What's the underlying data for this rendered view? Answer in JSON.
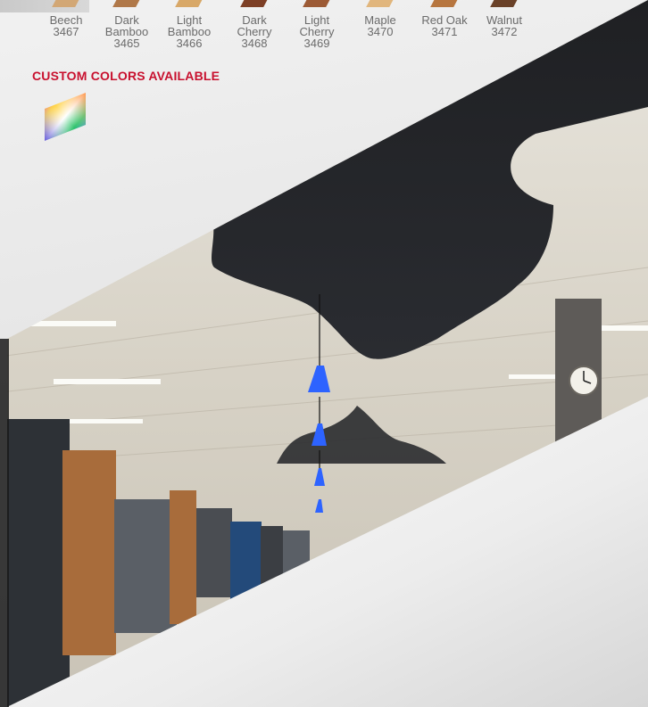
{
  "swatches": [
    {
      "name": "Beech",
      "code": "3467",
      "color": "#d2a775"
    },
    {
      "name": "Dark\nBamboo",
      "code": "3465",
      "color": "#b07849"
    },
    {
      "name": "Light\nBamboo",
      "code": "3466",
      "color": "#d8a868"
    },
    {
      "name": "Dark\nCherry",
      "code": "3468",
      "color": "#7d3f25"
    },
    {
      "name": "Light\nCherry",
      "code": "3469",
      "color": "#9c5a35"
    },
    {
      "name": "Maple",
      "code": "3470",
      "color": "#e1b67d"
    },
    {
      "name": "Red Oak",
      "code": "3471",
      "color": "#b7763f"
    },
    {
      "name": "Walnut",
      "code": "3472",
      "color": "#6a4128"
    }
  ],
  "custom": {
    "heading": "CUSTOM COLORS AVAILABLE",
    "icon": "color-spectrum-icon",
    "accent": "#c8102e"
  },
  "photo": {
    "subject": "office-ceiling-photo"
  }
}
